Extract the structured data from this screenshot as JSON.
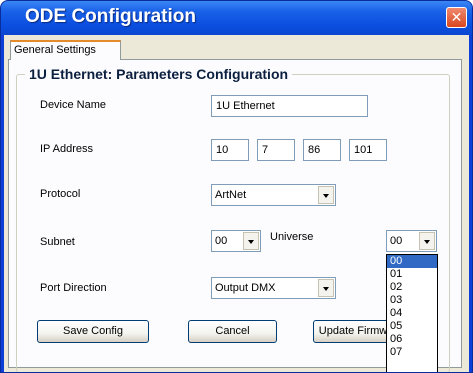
{
  "window": {
    "title": "ODE Configuration",
    "close_symbol": "✕"
  },
  "tabs": [
    {
      "label": "General Settings",
      "active": true
    }
  ],
  "group": {
    "title": "1U Ethernet: Parameters Configuration"
  },
  "fields": {
    "device_name": {
      "label": "Device Name",
      "value": "1U Ethernet"
    },
    "ip_address": {
      "label": "IP Address",
      "octets": [
        "10",
        "7",
        "86",
        "101"
      ]
    },
    "protocol": {
      "label": "Protocol",
      "value": "ArtNet"
    },
    "subnet": {
      "label": "Subnet",
      "value": "00"
    },
    "universe": {
      "label": "Universe",
      "value": "00"
    },
    "port_direction": {
      "label": "Port Direction",
      "value": "Output DMX"
    }
  },
  "buttons": {
    "save": "Save Config",
    "cancel": "Cancel",
    "update_firmware": "Update Firmw"
  },
  "universe_dropdown": {
    "options": [
      "00",
      "01",
      "02",
      "03",
      "04",
      "05",
      "06",
      "07"
    ],
    "selected_index": 0
  },
  "colors": {
    "titlebar": "#0b4fe0",
    "selection": "#316ac5",
    "tab_accent": "#e68b2c",
    "close_button": "#d9471f"
  }
}
